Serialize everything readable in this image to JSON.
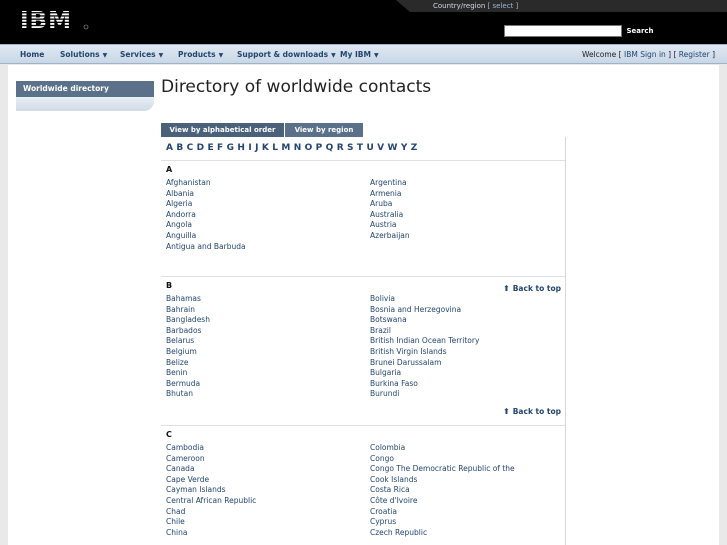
{
  "masthead": {
    "country_label": "Country/region",
    "country_select": "[ select ]",
    "logo_text": "IBM",
    "search_button": "Search"
  },
  "nav": {
    "items": [
      {
        "label": "Home"
      },
      {
        "label": "Solutions"
      },
      {
        "label": "Services"
      },
      {
        "label": "Products"
      },
      {
        "label": "Support & downloads"
      },
      {
        "label": "My IBM"
      }
    ],
    "welcome": "Welcome",
    "sign_in": "IBM Sign in",
    "register": "Register"
  },
  "left_nav": {
    "title": "Worldwide directory"
  },
  "page": {
    "title": "Directory of worldwide contacts"
  },
  "tabs": [
    {
      "label": "View by alphabetical order"
    },
    {
      "label": "View by region"
    }
  ],
  "alphabet": [
    "A",
    "B",
    "C",
    "D",
    "E",
    "F",
    "G",
    "H",
    "I",
    "J",
    "K",
    "L",
    "M",
    "N",
    "O",
    "P",
    "Q",
    "R",
    "S",
    "T",
    "U",
    "V",
    "W",
    "Y",
    "Z"
  ],
  "back_to_top": "Back to top",
  "sections": [
    {
      "letter": "A",
      "left": [
        "Afghanistan",
        "Albania",
        "Algeria",
        "Andorra",
        "Angola",
        "Anguilla",
        "Antigua and Barbuda"
      ],
      "right": [
        "Argentina",
        "Armenia",
        "Aruba",
        "Australia",
        "Austria",
        "Azerbaijan"
      ]
    },
    {
      "letter": "B",
      "left": [
        "Bahamas",
        "Bahrain",
        "Bangladesh",
        "Barbados",
        "Belarus",
        "Belgium",
        "Belize",
        "Benin",
        "Bermuda",
        "Bhutan"
      ],
      "right": [
        "Bolivia",
        "Bosnia and Herzegovina",
        "Botswana",
        "Brazil",
        "British Indian Ocean Territory",
        "British Virgin Islands",
        "Brunei Darussalam",
        "Bulgaria",
        "Burkina Faso",
        "Burundi"
      ]
    },
    {
      "letter": "C",
      "left": [
        "Cambodia",
        "Cameroon",
        "Canada",
        "Cape Verde",
        "Cayman Islands",
        "Central African Republic",
        "Chad",
        "Chile",
        "China"
      ],
      "right": [
        "Colombia",
        "Congo",
        "Congo The Democratic Republic of the",
        "Cook Islands",
        "Costa Rica",
        "Côte d'Ivoire",
        "Croatia",
        "Cyprus",
        "Czech Republic"
      ]
    }
  ]
}
